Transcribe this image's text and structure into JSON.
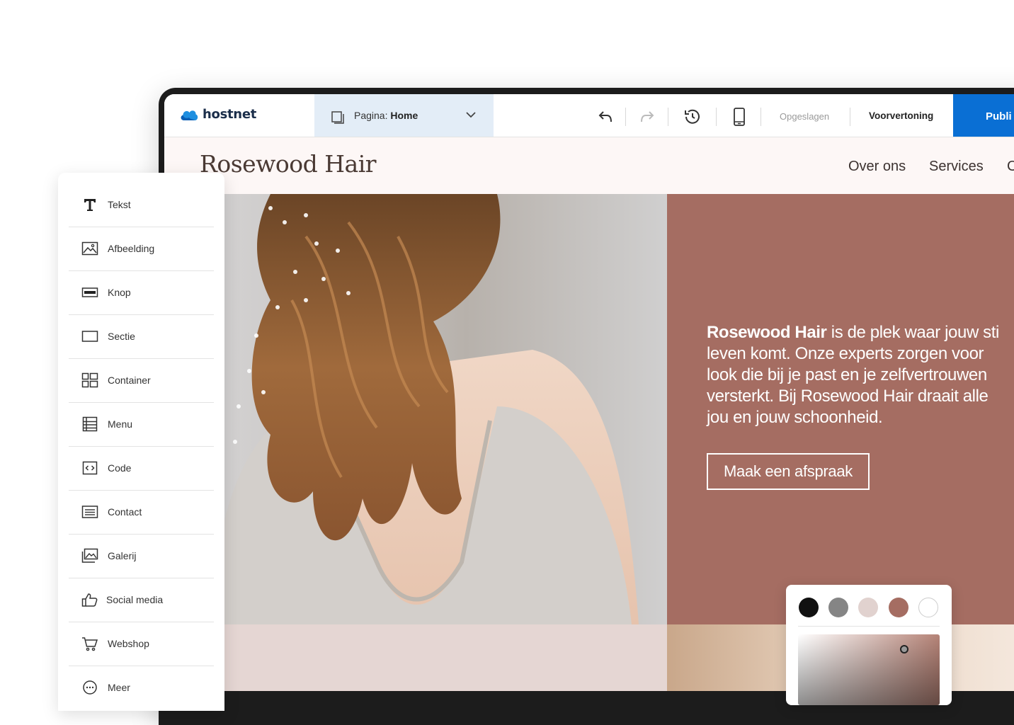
{
  "toolbar": {
    "logo": "hostnet",
    "page_prefix": "Pagina:",
    "page_name": "Home",
    "saved_label": "Opgeslagen",
    "preview_label": "Voorvertoning",
    "publish_label": "Publi"
  },
  "site": {
    "title": "Rosewood Hair",
    "nav": [
      "Over ons",
      "Services",
      "C"
    ],
    "hero": {
      "brand": "Rosewood Hair",
      "lines": [
        "is de plek waar jouw sti",
        "leven komt. Onze experts zorgen voor",
        "look die bij je past en je zelfvertrouwen",
        "versterkt. Bij Rosewood Hair draait alle",
        "jou en jouw schoonheid."
      ],
      "cta": "Maak een afspraak"
    }
  },
  "elements_panel": {
    "items": [
      {
        "label": "Tekst",
        "icon": "text-icon"
      },
      {
        "label": "Afbeelding",
        "icon": "image-icon"
      },
      {
        "label": "Knop",
        "icon": "button-icon"
      },
      {
        "label": "Sectie",
        "icon": "section-icon"
      },
      {
        "label": "Container",
        "icon": "container-icon"
      },
      {
        "label": "Menu",
        "icon": "menu-icon"
      },
      {
        "label": "Code",
        "icon": "code-icon"
      },
      {
        "label": "Contact",
        "icon": "contact-icon"
      },
      {
        "label": "Galerij",
        "icon": "gallery-icon"
      },
      {
        "label": "Social media",
        "icon": "thumbs-up-icon"
      },
      {
        "label": "Webshop",
        "icon": "cart-icon"
      },
      {
        "label": "Meer",
        "icon": "more-icon"
      }
    ]
  },
  "color_picker": {
    "swatches": [
      "#111111",
      "#858585",
      "#e1d2cf",
      "#a56d62",
      "#ffffff"
    ]
  },
  "colors": {
    "accent": "#0a6fd4",
    "hero_panel": "#a56d62",
    "page_select_bg": "#e3edf7"
  }
}
